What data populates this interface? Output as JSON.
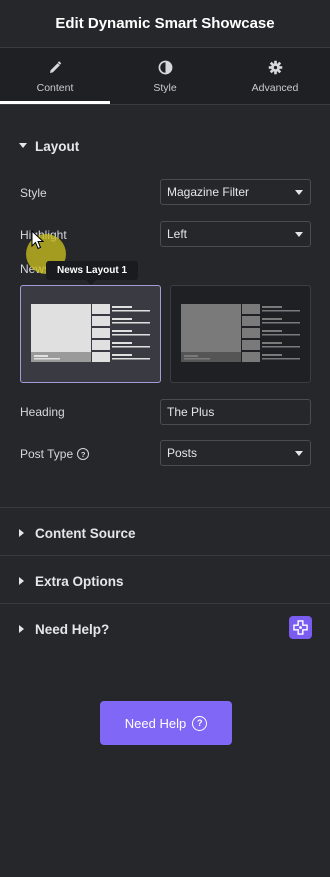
{
  "header": {
    "title": "Edit Dynamic Smart Showcase"
  },
  "tabs": [
    {
      "label": "Content",
      "icon": "pencil-icon",
      "active": true
    },
    {
      "label": "Style",
      "icon": "half-circle-icon",
      "active": false
    },
    {
      "label": "Advanced",
      "icon": "gear-icon",
      "active": false
    }
  ],
  "layout_section": {
    "title": "Layout",
    "style_label": "Style",
    "style_value": "Magazine Filter",
    "highlight_label": "Highlight",
    "highlight_value": "Left",
    "news_label": "News",
    "tooltip": "News Layout 1",
    "heading_label": "Heading",
    "heading_value": "The Plus",
    "post_type_label": "Post Type",
    "post_type_value": "Posts"
  },
  "sections": {
    "content_source": "Content Source",
    "extra_options": "Extra Options",
    "need_help": "Need Help?"
  },
  "need_help_button": {
    "label": "Need Help"
  },
  "colors": {
    "accent": "#8067f5",
    "background": "#26272b",
    "tab_bar": "#1f2024"
  }
}
